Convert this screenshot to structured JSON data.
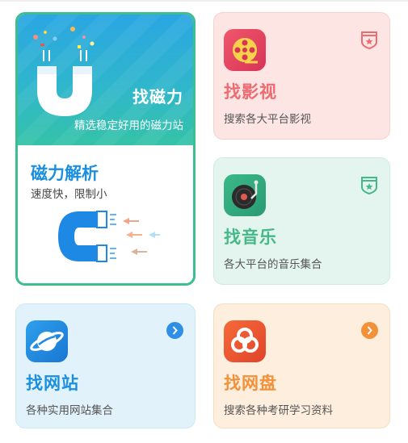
{
  "magnet_card": {
    "title": "找磁力",
    "subtitle": "精选稳定好用的磁力站",
    "section_title": "磁力解析",
    "section_subtitle": "速度快，限制小"
  },
  "movie_card": {
    "title": "找影视",
    "subtitle": "搜索各大平台影视",
    "title_color": "#ee6b72"
  },
  "music_card": {
    "title": "找音乐",
    "subtitle": "各大平台的音乐集合",
    "title_color": "#45b888"
  },
  "site_card": {
    "title": "找网站",
    "subtitle": "各种实用网站集合",
    "title_color": "#1a8fe0"
  },
  "disk_card": {
    "title": "找网盘",
    "subtitle": "搜索各种考研学习资料",
    "title_color": "#f2913a"
  },
  "icons": {
    "magnet": "magnet-icon",
    "movie": "film-reel-icon",
    "music": "record-player-icon",
    "site": "planet-icon",
    "disk": "cloud-disk-icon",
    "badge": "shield-badge-icon",
    "arrow": "chevron-right-icon"
  }
}
